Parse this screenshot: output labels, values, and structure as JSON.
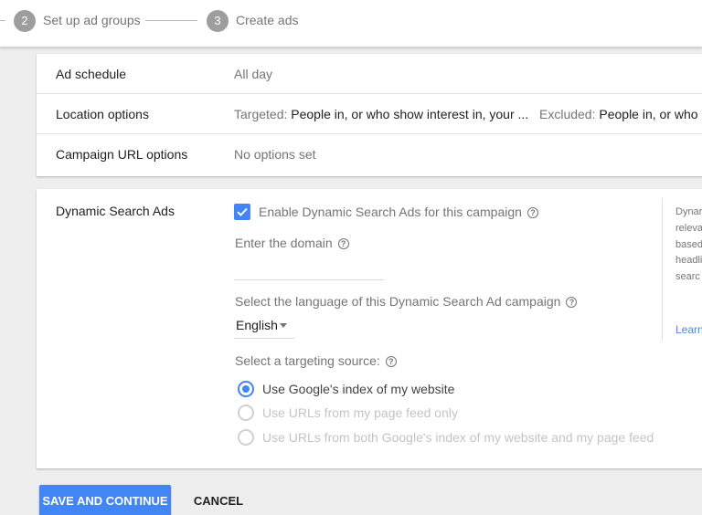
{
  "stepper": {
    "steps": [
      {
        "number": "2",
        "label": "Set up ad groups"
      },
      {
        "number": "3",
        "label": "Create ads"
      }
    ]
  },
  "settings": {
    "rows": [
      {
        "label": "Ad schedule",
        "value": "All day"
      },
      {
        "label": "Location options",
        "targeted_prefix": "Targeted:",
        "targeted_value": "People in, or who show interest in, your ...",
        "excluded_prefix": "Excluded:",
        "excluded_value": "People in, or who s"
      },
      {
        "label": "Campaign URL options",
        "value": "No options set"
      }
    ]
  },
  "dsa": {
    "title": "Dynamic Search Ads",
    "enable_label": "Enable Dynamic Search Ads for this campaign",
    "enable_checked": true,
    "domain_label": "Enter the domain",
    "domain_value": "",
    "language_label": "Select the language of this Dynamic Search Ad campaign",
    "language_value": "English",
    "targeting_label": "Select a targeting source:",
    "targeting_options": [
      {
        "label": "Use Google's index of my website",
        "selected": true,
        "enabled": true
      },
      {
        "label": "Use URLs from my page feed only",
        "selected": false,
        "enabled": false
      },
      {
        "label": "Use URLs from both Google's index of my website and my page feed",
        "selected": false,
        "enabled": false
      }
    ],
    "side_panel": {
      "text": "Dynar relevant based headli custo searc",
      "link": "Learn"
    },
    "help_icon": "?"
  },
  "actions": {
    "save_label": "SAVE AND CONTINUE",
    "cancel_label": "CANCEL"
  },
  "colors": {
    "accent": "#4285f4",
    "step_circle": "#9e9e9e",
    "background": "#eeeeee"
  }
}
